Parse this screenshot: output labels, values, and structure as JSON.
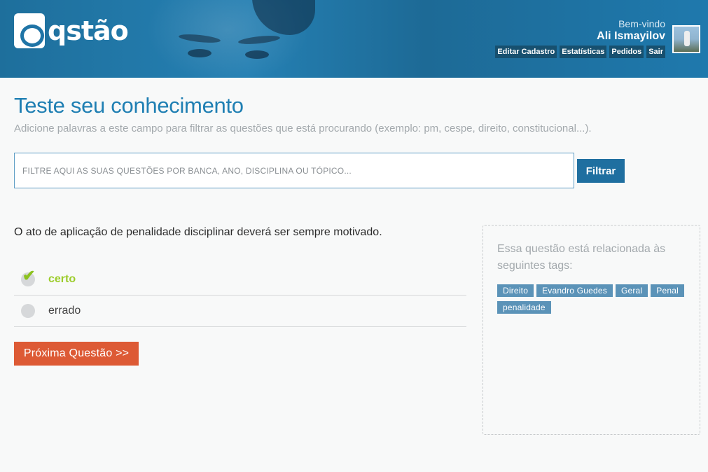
{
  "header": {
    "logo_text": "qstão",
    "welcome": "Bem-vindo",
    "user_name": "Ali Ismayilov",
    "links": [
      "Editar Cadastro",
      "Estatísticas",
      "Pedidos",
      "Sair"
    ]
  },
  "main": {
    "title": "Teste seu conhecimento",
    "subtitle": "Adicione palavras a este campo para filtrar as questões que está procurando (exemplo: pm, cespe, direito, constitucional...).",
    "search_placeholder": "FILTRE AQUI AS SUAS QUESTÕES POR BANCA, ANO, DISCIPLINA OU TÓPICO...",
    "filter_label": "Filtrar",
    "question": "O ato de aplicação de penalidade disciplinar deverá ser sempre motivado.",
    "options": [
      {
        "label": "certo",
        "state": "correct"
      },
      {
        "label": "errado",
        "state": "unselected"
      }
    ],
    "next_label": "Próxima Questão >>"
  },
  "tags_panel": {
    "intro": "Essa questão está relacionada às seguintes tags:",
    "tags": [
      "Direito",
      "Evandro Guedes",
      "Geral",
      "Penal",
      "penalidade"
    ]
  },
  "colors": {
    "header_blue": "#2580b3",
    "title_blue": "#1f7fb3",
    "filter_button": "#1f6fa0",
    "next_button": "#dd5a35",
    "correct_green": "#9ccc2a",
    "tag_blue": "#5b93b8"
  },
  "icons": {
    "logo": "qstao-logo-icon",
    "check": "check-icon",
    "radio": "radio-icon"
  }
}
